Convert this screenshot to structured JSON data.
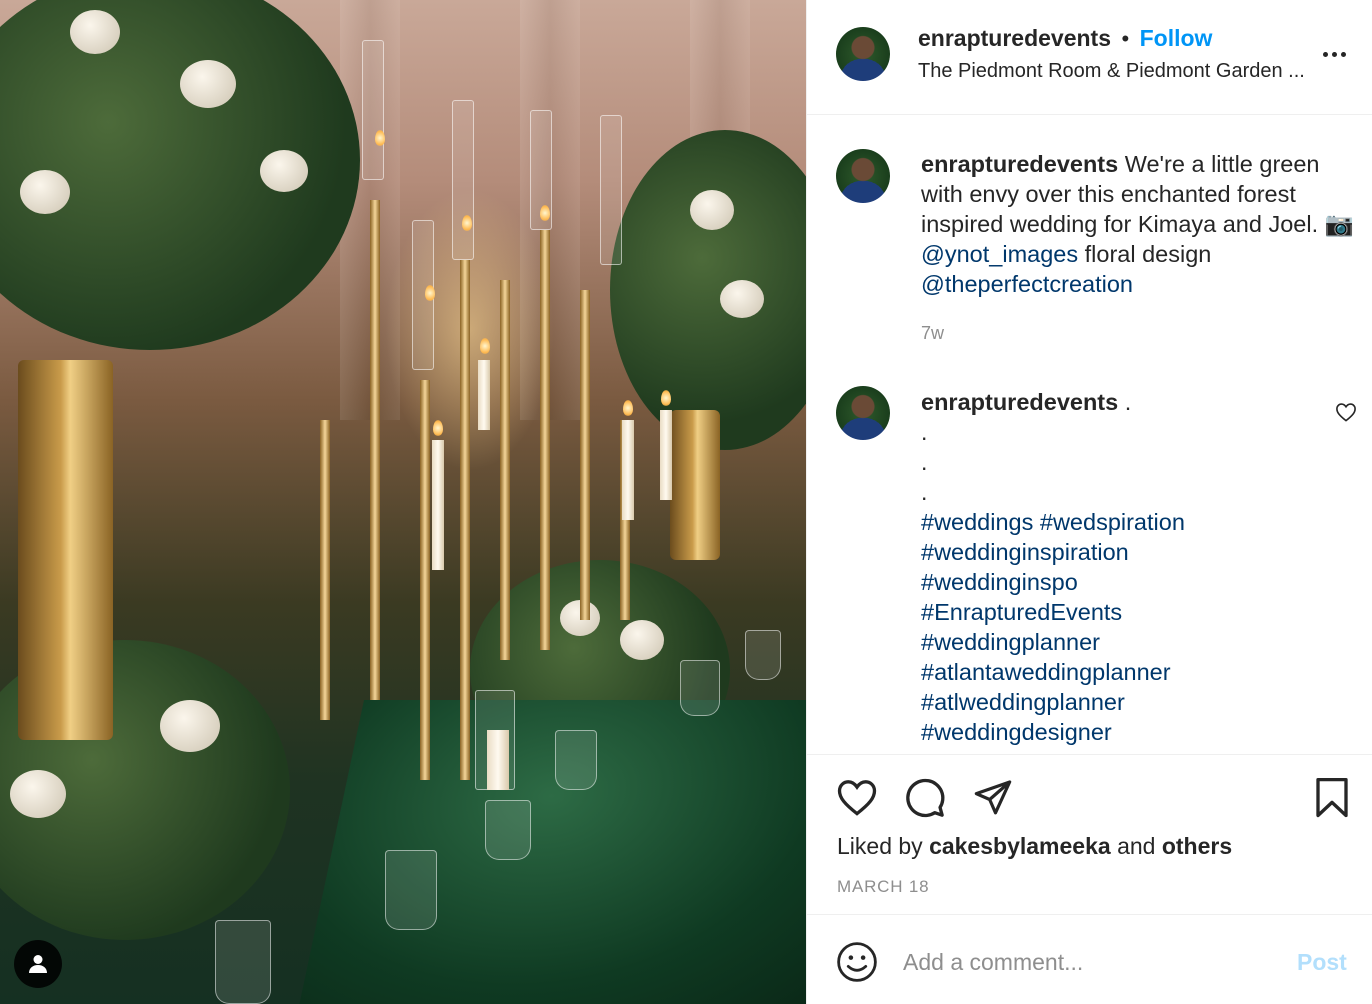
{
  "post": {
    "author": {
      "username": "enrapturedevents",
      "follow_label": "Follow",
      "separator": "•",
      "location": "The Piedmont Room & Piedmont Garden ..."
    },
    "caption": {
      "username": "enrapturedevents",
      "text_1": "We're a little green with envy over this enchanted forest inspired wedding for Kimaya and Joel.",
      "camera_emoji": "📷",
      "mention_1": "@ynot_images",
      "text_2": "floral design",
      "mention_2": "@theperfectcreation",
      "time": "7w"
    },
    "comment": {
      "username": "enrapturedevents",
      "first_line": ".",
      "dots": [
        ".",
        ".",
        "."
      ],
      "hashtags": [
        "#weddings #wedspiration",
        "#weddinginspiration",
        "#weddinginspo",
        "#EnrapturedEvents",
        "#weddingplanner",
        "#atlantaweddingplanner",
        "#atlweddingplanner",
        "#weddingdesigner"
      ]
    },
    "likes": {
      "prefix": "Liked by",
      "user": "cakesbylameeka",
      "connector": "and",
      "others": "others"
    },
    "date": "MARCH 18",
    "add_comment": {
      "placeholder": "Add a comment...",
      "post_label": "Post"
    }
  },
  "icons": {
    "more": "more-options-icon",
    "heart": "heart-icon",
    "comment": "comment-icon",
    "share": "share-icon",
    "save": "bookmark-icon",
    "emoji": "emoji-icon",
    "user_tag": "user-tag-icon"
  },
  "colors": {
    "follow": "#0095f6",
    "link": "#00376b",
    "muted": "#8e8e8e",
    "post_disabled": "#b2dffc"
  }
}
